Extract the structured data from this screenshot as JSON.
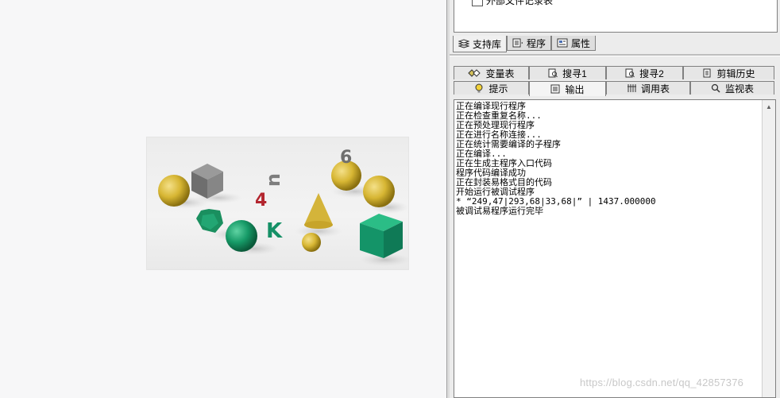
{
  "tree": {
    "item_label": "外部文件记录表"
  },
  "support_tabs": [
    {
      "label": "支持库",
      "icon": "library-icon"
    },
    {
      "label": "程序",
      "icon": "program-icon"
    },
    {
      "label": "属性",
      "icon": "properties-icon"
    }
  ],
  "output_tabs_row1": [
    {
      "label": "变量表",
      "icon": "variables-icon"
    },
    {
      "label": "搜寻1",
      "icon": "search1-icon"
    },
    {
      "label": "搜寻2",
      "icon": "search2-icon"
    },
    {
      "label": "剪辑历史",
      "icon": "clip-history-icon"
    }
  ],
  "output_tabs_row2": [
    {
      "label": "提示",
      "icon": "hint-icon"
    },
    {
      "label": "输出",
      "icon": "output-icon"
    },
    {
      "label": "调用表",
      "icon": "call-table-icon"
    },
    {
      "label": "监视表",
      "icon": "watch-icon"
    }
  ],
  "output": {
    "lines": [
      "正在编译现行程序",
      "正在检查重复名称...",
      "正在预处理现行程序",
      "正在进行名称连接...",
      "正在统计需要编译的子程序",
      "正在编译...",
      "正在生成主程序入口代码",
      "程序代码编译成功",
      "正在封装易格式目的代码",
      "开始运行被调试程序",
      "* “249,47|293,68|33,68|” | 1437.000000",
      "被调试易程序运行完毕"
    ]
  },
  "image_glyphs": {
    "digit_4": "4",
    "letter_u": "u",
    "letter_k": "K",
    "digit_6": "6"
  },
  "watermark": "https://blog.csdn.net/qq_42857376"
}
